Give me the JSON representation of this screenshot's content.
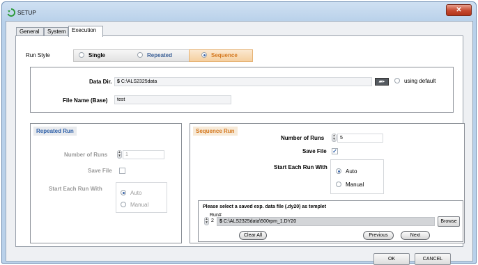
{
  "window": {
    "title": "SETUP"
  },
  "tabs": [
    {
      "label": "General"
    },
    {
      "label": "System"
    },
    {
      "label": "Execution"
    }
  ],
  "run_style": {
    "label": "Run Style",
    "options": [
      "Single",
      "Repeated",
      "Sequence"
    ],
    "selected": "Sequence"
  },
  "data_dir": {
    "label": "Data Dir.",
    "value": "C:\\ALS2325data",
    "using_default_label": "using default",
    "file_name_label": "File Name (Base)",
    "file_name_value": "test"
  },
  "repeated_run": {
    "title": "Repeated Run",
    "number_of_runs_label": "Number of Runs",
    "number_of_runs_value": "1",
    "save_file_label": "Save File",
    "start_each_run_label": "Start Each Run With",
    "options": [
      "Auto",
      "Manual"
    ]
  },
  "sequence_run": {
    "title": "Sequence Run",
    "number_of_runs_label": "Number of Runs",
    "number_of_runs_value": "5",
    "save_file_label": "Save File",
    "save_file_checked": true,
    "start_each_run_label": "Start Each Run With",
    "options": [
      "Auto",
      "Manual"
    ],
    "selected": "Auto"
  },
  "templet": {
    "instruction": "Please select a saved exp. data file (.dy20) as templet",
    "run_label": "Run#",
    "run_value": "2",
    "file_path": "C:\\ALS2325data\\500rpm_1.DY20",
    "browse_label": "Browse",
    "clear_all_label": "Clear All",
    "previous_label": "Previous",
    "next_label": "Next"
  },
  "footer": {
    "ok_label": "OK",
    "cancel_label": "CANCEL"
  },
  "colors": {
    "accent_blue": "#2d5fa8",
    "accent_orange": "#d4781f",
    "close_red": "#c6492f"
  },
  "icons": [
    "app-icon",
    "close-icon",
    "folder-icon",
    "spinner-icon",
    "check-icon"
  ]
}
